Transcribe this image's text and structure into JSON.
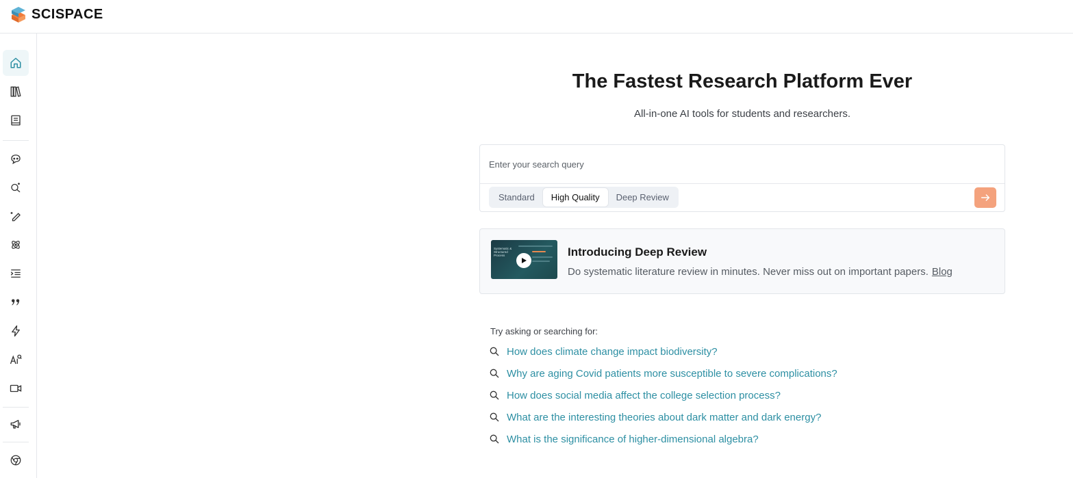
{
  "brand": {
    "name": "SCISPACE"
  },
  "sidebar": {
    "items": [
      {
        "icon": "home-icon",
        "active": true
      },
      {
        "icon": "library-icon"
      },
      {
        "icon": "notebook-icon"
      },
      {
        "icon": "chat-bot-icon"
      },
      {
        "icon": "search-sparkle-icon"
      },
      {
        "icon": "pen-sparkle-icon"
      },
      {
        "icon": "atom-icon"
      },
      {
        "icon": "outline-list-icon"
      },
      {
        "icon": "quote-icon"
      },
      {
        "icon": "lightning-icon"
      },
      {
        "icon": "ai-detector-icon"
      },
      {
        "icon": "video-icon"
      },
      {
        "icon": "megaphone-icon"
      },
      {
        "icon": "chrome-icon"
      }
    ]
  },
  "hero": {
    "title": "The Fastest Research Platform Ever",
    "subtitle": "All-in-one AI tools for students and researchers."
  },
  "search": {
    "placeholder": "Enter your search query",
    "value": "",
    "modes": [
      "Standard",
      "High Quality",
      "Deep Review"
    ],
    "selected_mode": "High Quality"
  },
  "promo": {
    "title": "Introducing Deep Review",
    "description": "Do systematic literature review in minutes. Never miss out on important papers.",
    "link": "Blog",
    "thumbnail_text": "Systematic & Structured Process"
  },
  "suggestions": {
    "label": "Try asking or searching for:",
    "items": [
      "How does climate change impact biodiversity?",
      "Why are aging Covid patients more susceptible to severe complications?",
      "How does social media affect the college selection process?",
      "What are the interesting theories about dark matter and dark energy?",
      "What is the significance of higher-dimensional algebra?"
    ]
  },
  "colors": {
    "accent": "#2d8fa3",
    "submit": "#f4a27d",
    "logo_blue": "#4aa3c9",
    "logo_orange": "#f07b3a"
  }
}
